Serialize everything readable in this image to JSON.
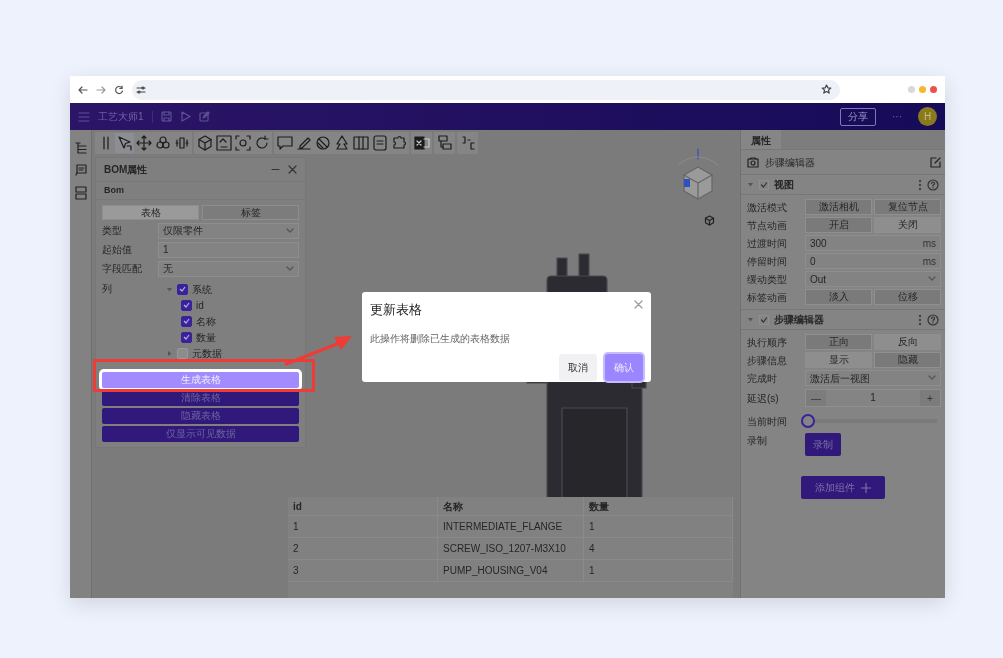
{
  "app_header": {
    "title": "工艺大师1",
    "share_button": "分享",
    "more_button": "···",
    "avatar": "H"
  },
  "bom_panel": {
    "title": "BOM属性",
    "subtitle": "Bom",
    "tabs": [
      {
        "label": "表格",
        "selected": true
      },
      {
        "label": "标签",
        "selected": false
      }
    ],
    "fields": [
      {
        "kind": "select",
        "label": "类型",
        "value": "仅限零件"
      },
      {
        "kind": "input",
        "label": "起始值",
        "value": "1"
      },
      {
        "kind": "select",
        "label": "字段匹配",
        "value": "无"
      }
    ],
    "columns_label": "列",
    "columns": [
      {
        "label": "系统",
        "checked": true,
        "expanded": true,
        "children": [
          {
            "label": "id",
            "checked": true
          },
          {
            "label": "名称",
            "checked": true
          },
          {
            "label": "数量",
            "checked": true
          }
        ]
      },
      {
        "label": "元数据",
        "checked": false,
        "expanded": false
      }
    ],
    "buttons": [
      {
        "label": "生成表格",
        "highlighted": true
      },
      {
        "label": "清除表格",
        "highlighted": false
      },
      {
        "label": "隐藏表格",
        "highlighted": false
      },
      {
        "label": "仅显示可见数据",
        "highlighted": false
      }
    ]
  },
  "properties_panel": {
    "tab": "属性",
    "editor_title": "步骤编辑器",
    "sections": [
      {
        "title": "视图",
        "checked": true,
        "expanded": true,
        "rows": [
          {
            "kind": "toggle",
            "label": "激活模式",
            "options": [
              {
                "label": "激活相机",
                "selected": true
              },
              {
                "label": "复位节点",
                "selected": true
              }
            ]
          },
          {
            "kind": "toggle",
            "label": "节点动画",
            "options": [
              {
                "label": "开启",
                "selected": true
              },
              {
                "label": "关闭",
                "selected": false
              }
            ]
          },
          {
            "kind": "number",
            "label": "过渡时间",
            "value": "300",
            "unit": "ms"
          },
          {
            "kind": "number",
            "label": "停留时间",
            "value": "0",
            "unit": "ms"
          },
          {
            "kind": "select",
            "label": "缓动类型",
            "value": "Out"
          },
          {
            "kind": "toggle",
            "label": "标签动画",
            "options": [
              {
                "label": "淡入",
                "selected": true
              },
              {
                "label": "位移",
                "selected": true
              }
            ]
          }
        ]
      },
      {
        "title": "步骤编辑器",
        "checked": true,
        "expanded": true,
        "rows": [
          {
            "kind": "toggle",
            "label": "执行顺序",
            "options": [
              {
                "label": "正向",
                "selected": true
              },
              {
                "label": "反向",
                "selected": false
              }
            ]
          },
          {
            "kind": "toggle",
            "label": "步骤信息",
            "options": [
              {
                "label": "显示",
                "selected": false
              },
              {
                "label": "隐藏",
                "selected": true
              }
            ]
          },
          {
            "kind": "select",
            "label": "完成时",
            "value": "激活后一视图"
          },
          {
            "kind": "stepper",
            "label": "延迟(s)",
            "value": "1",
            "minus": "—",
            "plus": "+"
          },
          {
            "kind": "slider",
            "label": "当前时间",
            "level": 0
          },
          {
            "kind": "button",
            "label": "录制",
            "button": "录制"
          }
        ]
      }
    ],
    "add_button": "添加组件"
  },
  "table": {
    "columns": [
      "id",
      "名称",
      "数量"
    ],
    "rows": [
      [
        "1",
        "INTERMEDIATE_FLANGE",
        "1"
      ],
      [
        "2",
        "SCREW_ISO_1207-M3X10",
        "4"
      ],
      [
        "3",
        "PUMP_HOUSING_V04",
        "1"
      ]
    ]
  },
  "dialog": {
    "title": "更新表格",
    "message": "此操作将删除已生成的表格数据",
    "buttons": [
      {
        "label": "取消",
        "primary": false
      },
      {
        "label": "确认",
        "primary": true
      }
    ]
  }
}
